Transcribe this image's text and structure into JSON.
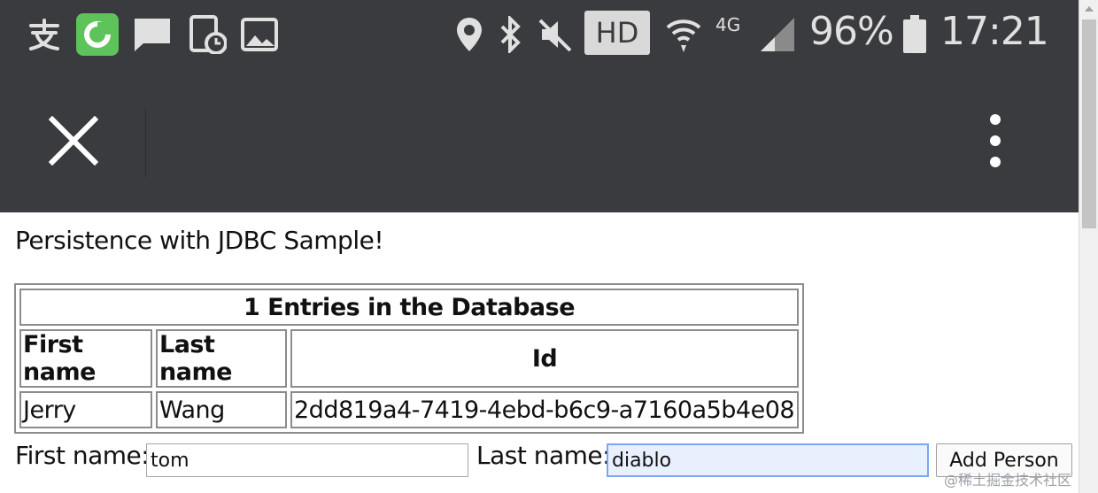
{
  "status_bar": {
    "hd_badge": "HD",
    "network": "4G",
    "battery": "96%",
    "time": "17:21",
    "icons": [
      "alipay-icon",
      "wechat-icon",
      "message-icon",
      "tablet-clock-icon",
      "image-icon",
      "location-icon",
      "bluetooth-icon",
      "mute-icon",
      "wifi-icon",
      "signal-icon",
      "battery-icon"
    ]
  },
  "app_bar": {
    "close_icon": "close-icon",
    "menu_icon": "more-vert-icon"
  },
  "page": {
    "heading": "Persistence with JDBC Sample!"
  },
  "table": {
    "caption": "1 Entries in the Database",
    "headers": [
      "First name",
      "Last name",
      "Id"
    ],
    "rows": [
      [
        "Jerry",
        "Wang",
        "2dd819a4-7419-4ebd-b6c9-a7160a5b4e08"
      ]
    ]
  },
  "form": {
    "first_name_label": "First name:",
    "first_name_value": "tom",
    "last_name_label": "Last name:",
    "last_name_value": "diablo",
    "add_button": "Add Person"
  },
  "watermark": "@稀土掘金技术社区",
  "colors": {
    "bar_bg": "#3a3b3e",
    "focus_bg": "#e8f0fe",
    "focus_border": "#7aa7ee",
    "wechat_green": "#5ec35a"
  }
}
